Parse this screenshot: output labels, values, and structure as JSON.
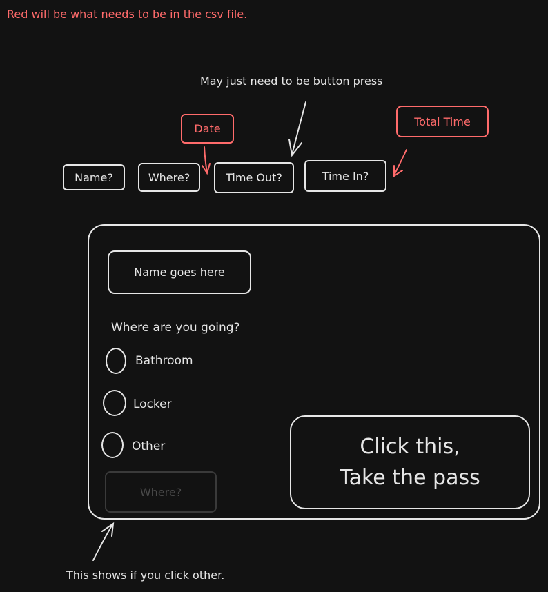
{
  "notes": {
    "csv_note": "Red will be what needs to be in the csv file.",
    "button_note": "May just need to be button press",
    "other_note": "This shows if you click other."
  },
  "fields": {
    "name": "Name?",
    "where": "Where?",
    "time_out": "Time Out?",
    "time_in": "Time In?"
  },
  "csv_labels": {
    "date": "Date",
    "total_time": "Total Time"
  },
  "form": {
    "name_placeholder": "Name goes here",
    "question": "Where are you going?",
    "options": [
      "Bathroom",
      "Locker",
      "Other"
    ],
    "other_placeholder": "Where?",
    "pass_line1": "Click this,",
    "pass_line2": "Take the pass"
  },
  "colors": {
    "background": "#121212",
    "red": "#ff6b6b",
    "line": "#e6e6e6"
  }
}
